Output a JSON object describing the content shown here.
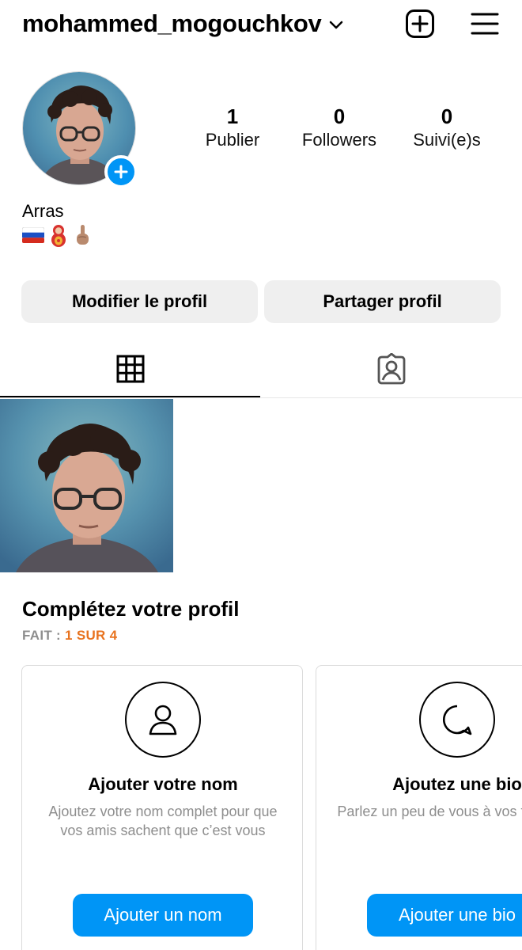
{
  "header": {
    "username": "mohammed_mogouchkov",
    "icons": {
      "dropdown": "chevron-down-icon",
      "add": "plus-square-icon",
      "menu": "hamburger-menu-icon"
    }
  },
  "profile": {
    "stats": [
      {
        "num": "1",
        "label": "Publier"
      },
      {
        "num": "0",
        "label": "Followers"
      },
      {
        "num": "0",
        "label": "Suivi(e)s"
      }
    ],
    "bio_name": "Arras",
    "bio_emojis": [
      "russia-flag",
      "matryoshka-doll",
      "index-pointing-up"
    ]
  },
  "actions": {
    "edit_label": "Modifier le profil",
    "share_label": "Partager profil"
  },
  "tabs": [
    {
      "name": "posts-grid",
      "icon": "grid-icon",
      "active": true
    },
    {
      "name": "tagged",
      "icon": "tagged-person-icon",
      "active": false
    }
  ],
  "complete_profile": {
    "title": "Complétez votre profil",
    "progress_prefix": "FAIT : ",
    "progress_value": "1 SUR 4",
    "cards": [
      {
        "icon": "person-icon",
        "title": "Ajouter votre nom",
        "desc": "Ajoutez votre nom complet pour que vos amis sachent que c’est vous",
        "button": "Ajouter un nom"
      },
      {
        "icon": "speech-bubble-icon",
        "title": "Ajoutez une bio",
        "desc": "Parlez un peu de vous à vos followers",
        "button": "Ajouter une bio"
      }
    ]
  },
  "colors": {
    "accent": "#0095f6",
    "progress": "#e8731f",
    "button_bg": "#efefef",
    "muted_text": "#8e8e8e",
    "border": "#dbdbdb"
  }
}
